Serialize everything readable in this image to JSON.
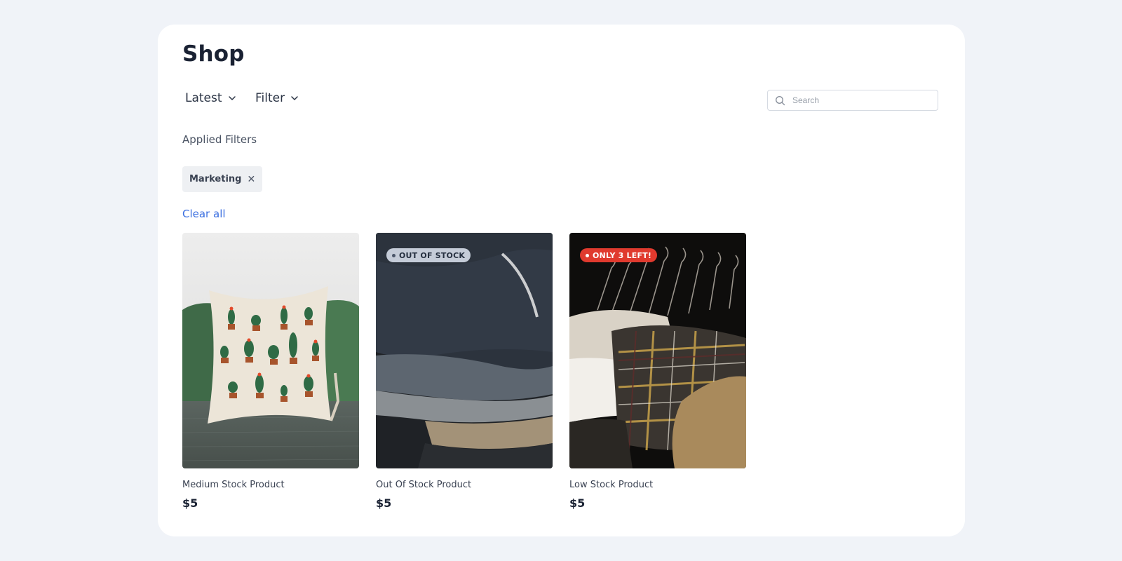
{
  "page": {
    "title": "Shop"
  },
  "toolbar": {
    "sort_label": "Latest",
    "filter_label": "Filter",
    "search_placeholder": "Search",
    "search_value": ""
  },
  "filters": {
    "heading": "Applied Filters",
    "chips": [
      {
        "label": "Marketing",
        "remove_glyph": "✕"
      }
    ],
    "clear_label": "Clear all"
  },
  "products": [
    {
      "name": "Medium Stock Product",
      "price": "$5",
      "badge": "",
      "image": "cactus-pillow-on-green-sofa"
    },
    {
      "name": "Out Of Stock Product",
      "price": "$5",
      "badge": "OUT OF STOCK",
      "badge_color": "#c5ccd8",
      "image": "folded-sweaters"
    },
    {
      "name": "Low Stock Product",
      "price": "$5",
      "badge": "ONLY 3 LEFT!",
      "badge_color": "#e03a2e",
      "image": "shirts-on-hangers"
    }
  ],
  "colors": {
    "background": "#f0f3f8",
    "card": "#ffffff",
    "link": "#3b6fe0",
    "text": "#1a2233"
  }
}
